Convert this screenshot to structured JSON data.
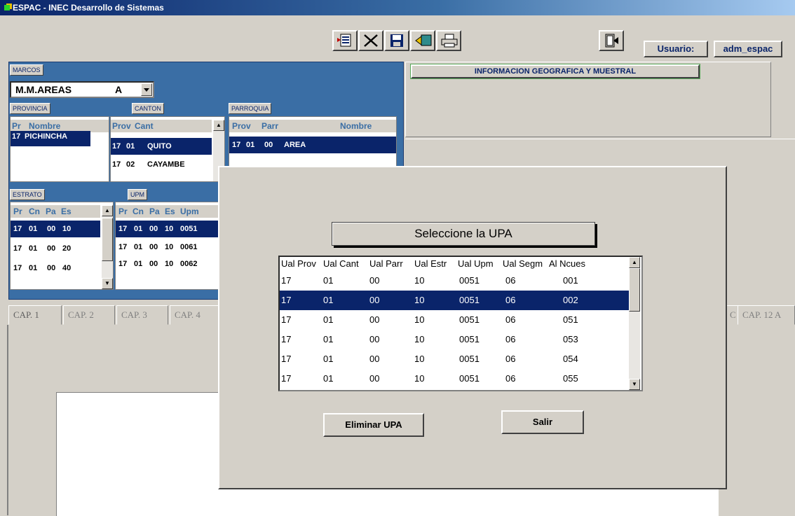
{
  "window": {
    "title": "ESPAC - INEC Desarrollo de Sistemas"
  },
  "toolbar": {
    "buttons": [
      {
        "name": "new-record-icon"
      },
      {
        "name": "delete-icon"
      },
      {
        "name": "save-icon"
      },
      {
        "name": "back-icon"
      },
      {
        "name": "print-icon"
      },
      {
        "name": "exit-icon"
      }
    ],
    "user_label": "Usuario:",
    "user_value": "adm_espac"
  },
  "marcos": {
    "label": "MARCOS",
    "combo_value": "M.M.AREAS",
    "combo_code": "A"
  },
  "provincia": {
    "label": "PROVINCIA",
    "headers": [
      "Pr",
      "Nombre"
    ],
    "rows": [
      {
        "pr": "17",
        "nombre": "PICHINCHA"
      }
    ]
  },
  "canton": {
    "label": "CANTON",
    "headers": [
      "Prov",
      "Cant"
    ],
    "rows": [
      {
        "prov": "17",
        "cant": "01",
        "nombre": "QUITO"
      },
      {
        "prov": "17",
        "cant": "02",
        "nombre": "CAYAMBE"
      }
    ]
  },
  "parroquia": {
    "label": "PARROQUIA",
    "headers": [
      "Prov",
      "Parr",
      "Nombre"
    ],
    "rows": [
      {
        "prov": "17",
        "cant": "01",
        "parr": "00",
        "nombre": "AREA"
      }
    ]
  },
  "estrato": {
    "label": "ESTRATO",
    "headers": [
      "Pr",
      "Cn",
      "Pa",
      "Es"
    ],
    "rows": [
      {
        "pr": "17",
        "cn": "01",
        "pa": "00",
        "es": "10"
      },
      {
        "pr": "17",
        "cn": "01",
        "pa": "00",
        "es": "20"
      },
      {
        "pr": "17",
        "cn": "01",
        "pa": "00",
        "es": "40"
      }
    ]
  },
  "upm": {
    "label": "UPM",
    "headers": [
      "Pr",
      "Cn",
      "Pa",
      "Es",
      "Upm"
    ],
    "rows": [
      {
        "pr": "17",
        "cn": "01",
        "pa": "00",
        "es": "10",
        "upm": "0051"
      },
      {
        "pr": "17",
        "cn": "01",
        "pa": "00",
        "es": "10",
        "upm": "0061"
      },
      {
        "pr": "17",
        "cn": "01",
        "pa": "00",
        "es": "10",
        "upm": "0062"
      }
    ]
  },
  "geo": {
    "label": "INFORMACION GEOGRAFICA Y MUESTRAL"
  },
  "tabs": [
    "CAP. 1",
    "CAP. 2",
    "CAP. 3",
    "CAP. 4",
    "C",
    "CAP. 12 A"
  ],
  "dialog": {
    "title": "Seleccione la UPA",
    "headers": [
      "Ual Prov",
      "Ual Cant",
      "Ual Parr",
      "Ual Estr",
      "Ual Upm",
      "Ual Segm",
      "Al Ncues"
    ],
    "rows": [
      [
        "17",
        "01",
        "00",
        "10",
        "0051",
        "06",
        "001"
      ],
      [
        "17",
        "01",
        "00",
        "10",
        "0051",
        "06",
        "002"
      ],
      [
        "17",
        "01",
        "00",
        "10",
        "0051",
        "06",
        "051"
      ],
      [
        "17",
        "01",
        "00",
        "10",
        "0051",
        "06",
        "053"
      ],
      [
        "17",
        "01",
        "00",
        "10",
        "0051",
        "06",
        "054"
      ],
      [
        "17",
        "01",
        "00",
        "10",
        "0051",
        "06",
        "055"
      ]
    ],
    "selected_row": 1,
    "eliminar_label": "Eliminar UPA",
    "salir_label": "Salir"
  }
}
